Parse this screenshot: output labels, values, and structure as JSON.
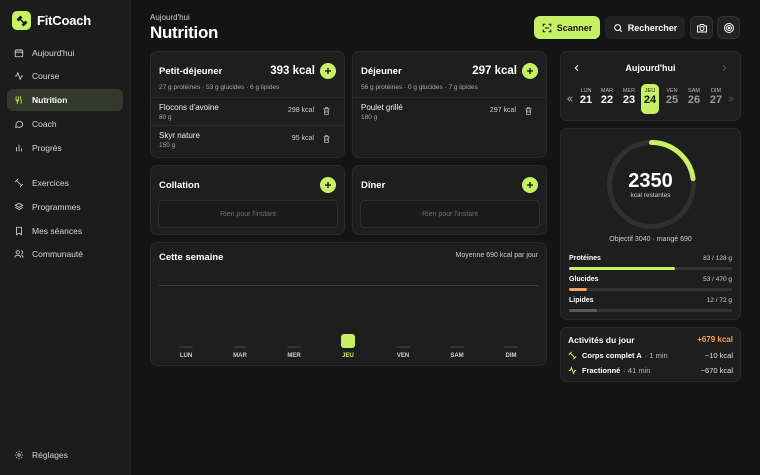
{
  "brand": {
    "name": "FitCoach"
  },
  "sidebar": {
    "items": [
      {
        "label": "Aujourd'hui",
        "icon": "calendar-icon"
      },
      {
        "label": "Course",
        "icon": "activity-icon"
      },
      {
        "label": "Nutrition",
        "icon": "utensils-icon",
        "active": true
      },
      {
        "label": "Coach",
        "icon": "chat-icon"
      },
      {
        "label": "Progrès",
        "icon": "bar-chart-icon"
      },
      {
        "label": "Exercices",
        "icon": "dumbbell-icon"
      },
      {
        "label": "Programmes",
        "icon": "layers-icon"
      },
      {
        "label": "Mes séances",
        "icon": "bookmark-icon"
      },
      {
        "label": "Communauté",
        "icon": "users-icon"
      }
    ],
    "settings_label": "Réglages"
  },
  "header": {
    "subtitle": "Aujourd'hui",
    "title": "Nutrition",
    "scan_label": "Scanner",
    "search_label": "Rechercher"
  },
  "meals": {
    "breakfast": {
      "title": "Petit-déjeuner",
      "kcal": "393 kcal",
      "macros": "27 g protéines · 53 g glucides · 6 g lipides",
      "items": [
        {
          "name": "Flocons d'avoine",
          "qty": "80 g",
          "kcal": "298 kcal"
        },
        {
          "name": "Skyr nature",
          "qty": "150 g",
          "kcal": "95 kcal"
        }
      ]
    },
    "lunch": {
      "title": "Déjeuner",
      "kcal": "297 kcal",
      "macros": "56 g protéines · 0 g glucides · 7 g lipides",
      "items": [
        {
          "name": "Poulet grillé",
          "qty": "180 g",
          "kcal": "297 kcal"
        }
      ]
    },
    "snack": {
      "title": "Collation",
      "empty": "Rien pour l'instant"
    },
    "dinner": {
      "title": "Dîner",
      "empty": "Rien pour l'instant"
    }
  },
  "week": {
    "title": "Cette semaine",
    "average": "Moyenne 690 kcal par jour",
    "days": [
      {
        "label": "LUN"
      },
      {
        "label": "MAR"
      },
      {
        "label": "MER"
      },
      {
        "label": "JEU",
        "today": true
      },
      {
        "label": "VEN"
      },
      {
        "label": "SAM"
      },
      {
        "label": "DIM"
      }
    ]
  },
  "calendar": {
    "title": "Aujourd'hui",
    "days": [
      {
        "name": "LUN",
        "num": "21"
      },
      {
        "name": "MAR",
        "num": "22"
      },
      {
        "name": "MER",
        "num": "23"
      },
      {
        "name": "JEU",
        "num": "24",
        "today": true
      },
      {
        "name": "VEN",
        "num": "25",
        "future": true
      },
      {
        "name": "SAM",
        "num": "26",
        "future": true
      },
      {
        "name": "DIM",
        "num": "27",
        "future": true
      }
    ]
  },
  "summary": {
    "remaining": "2350",
    "remaining_label": "kcal restantes",
    "goal_text": "Objectif 3040 · mangé 690",
    "progress": 0.227,
    "macros": [
      {
        "name": "Protéines",
        "value": "83 / 128 g",
        "fraction": 0.65,
        "color": "#c8f064"
      },
      {
        "name": "Glucides",
        "value": "53 / 470 g",
        "fraction": 0.11,
        "color": "#f0a060"
      },
      {
        "name": "Lipides",
        "value": "12 / 72 g",
        "fraction": 0.17,
        "color": "#5a5a5a"
      }
    ]
  },
  "activities": {
    "title": "Activités du jour",
    "total": "+679 kcal",
    "items": [
      {
        "name": "Corps complet A",
        "duration": "· 1 min",
        "kcal": "~10 kcal",
        "icon": "dumbbell-icon"
      },
      {
        "name": "Fractionné",
        "duration": "· 41 min",
        "kcal": "~670 kcal",
        "icon": "activity-icon"
      }
    ]
  },
  "colors": {
    "accent": "#c8f064",
    "orange": "#f0a060",
    "card": "#1e1e1e"
  }
}
